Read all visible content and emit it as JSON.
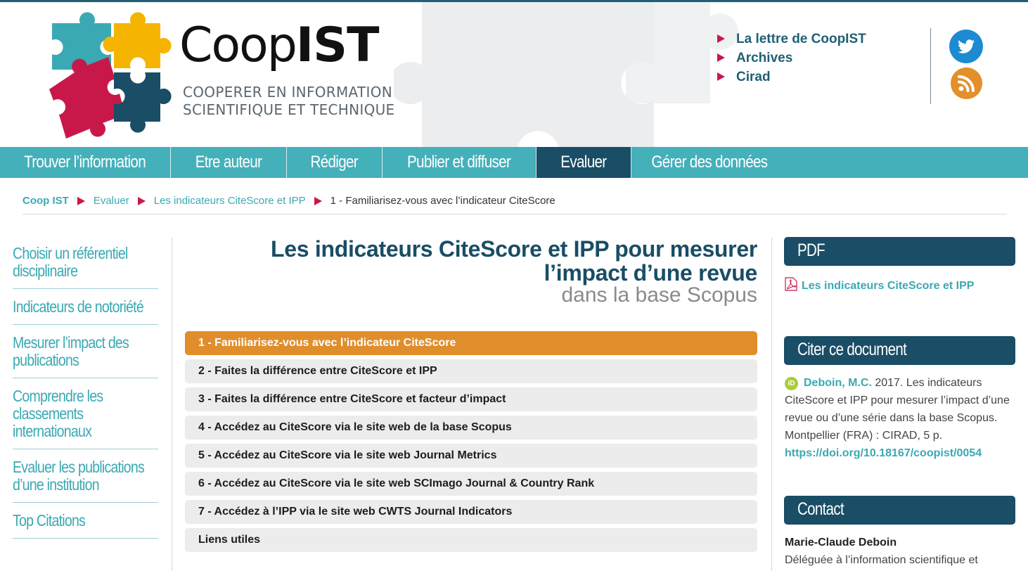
{
  "colors": {
    "teal": "#44b0ba",
    "dark_blue": "#1a4d66",
    "orange": "#e08e2c",
    "magenta": "#c8184a",
    "link": "#3aa9b3"
  },
  "header": {
    "brand_coop": "Coop",
    "brand_ist": "IST",
    "tagline_1": "COOPERER EN INFORMATION",
    "tagline_2": "SCIENTIFIQUE ET TECHNIQUE",
    "links": [
      "La lettre de CoopIST",
      "Archives",
      "Cirad"
    ],
    "social": [
      "twitter-icon",
      "rss-icon"
    ]
  },
  "nav": {
    "items": [
      {
        "label": "Trouver l’information",
        "active": false
      },
      {
        "label": "Etre auteur",
        "active": false
      },
      {
        "label": "Rédiger",
        "active": false
      },
      {
        "label": "Publier et diffuser",
        "active": false
      },
      {
        "label": "Evaluer",
        "active": true
      },
      {
        "label": "Gérer des données",
        "active": false
      }
    ]
  },
  "breadcrumb": {
    "home": "Coop IST",
    "c1": "Evaluer",
    "c2": "Les indicateurs CiteScore et IPP",
    "current": "1 - Familiarisez-vous avec l’indicateur CiteScore"
  },
  "sidebar": {
    "items": [
      {
        "line1": "Choisir un référentiel",
        "line2": "disciplinaire",
        "line3": ""
      },
      {
        "line1": "Indicateurs de notoriété",
        "line2": "",
        "line3": ""
      },
      {
        "line1": "Mesurer l’impact des",
        "line2": "publications",
        "line3": ""
      },
      {
        "line1": "Comprendre les",
        "line2": "classements",
        "line3": "internationaux"
      },
      {
        "line1": "Evaluer les publications",
        "line2": "d’une institution",
        "line3": ""
      },
      {
        "line1": "Top Citations",
        "line2": "",
        "line3": ""
      }
    ]
  },
  "main": {
    "title_line1": "Les indicateurs CiteScore et IPP pour mesurer",
    "title_line2": "l’impact d’une revue",
    "subtitle": "dans la base Scopus",
    "steps": [
      "1 - Familiarisez-vous avec l’indicateur CiteScore",
      "2 - Faites la différence entre CiteScore et IPP",
      "3 - Faites la différence entre CiteScore et facteur d’impact",
      "4 - Accédez au CiteScore via le site web de la base Scopus",
      "5 - Accédez au CiteScore via le site web Journal Metrics",
      "6 - Accédez au CiteScore via le site web SCImago Journal & Country Rank",
      "7 - Accédez à l’IPP via le site web CWTS Journal Indicators",
      "Liens utiles"
    ],
    "current_step": 0
  },
  "right": {
    "pdf_title": "PDF",
    "pdf_link": "Les indicateurs CiteScore et IPP",
    "cite_title": "Citer ce document",
    "orcid_label": "iD",
    "cite_author": "Deboin, M.C.",
    "cite_text": " 2017. Les indicateurs CiteScore et IPP pour mesurer l’impact d’une revue ou d’une série dans la base Scopus. Montpellier (FRA) : CIRAD, 5 p. ",
    "cite_doi": "https://doi.org/10.18167/coopist/0054",
    "contact_title": "Contact",
    "contact_name": "Marie-Claude Deboin",
    "contact_role": "Déléguée à l’information scientifique et"
  }
}
